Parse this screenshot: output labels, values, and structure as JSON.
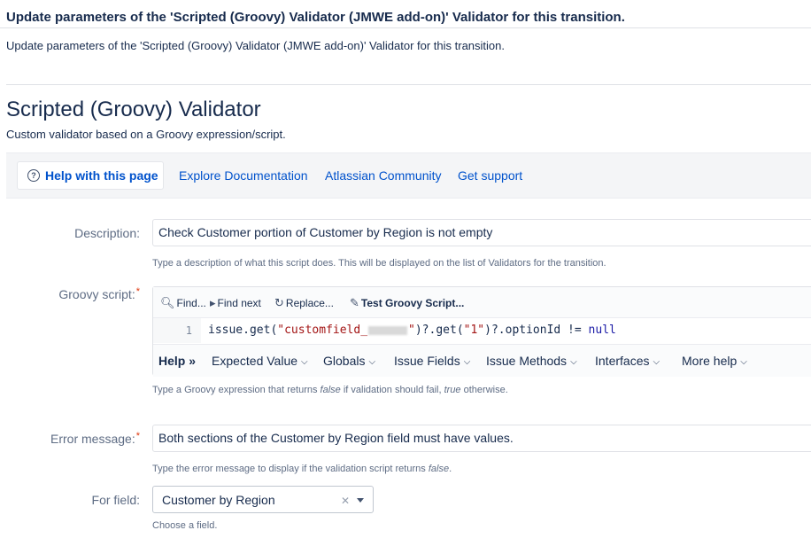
{
  "page": {
    "header_title": "Update parameters of the 'Scripted (Groovy) Validator (JMWE add-on)' Validator for this transition.",
    "description": "Update parameters of the 'Scripted (Groovy) Validator (JMWE add-on)' Validator for this transition."
  },
  "plugin": {
    "title": "Scripted (Groovy) Validator",
    "subtitle": "Custom validator based on a Groovy expression/script."
  },
  "help_bar": {
    "help_icon": "question-circle-icon",
    "help_page": "Help with this page",
    "links": [
      "Explore Documentation",
      "Atlassian Community",
      "Get support"
    ]
  },
  "form": {
    "description": {
      "label": "Description:",
      "value": "Check Customer portion of Customer by Region is not empty",
      "hint": "Type a description of what this script does. This will be displayed on the list of Validators for the transition."
    },
    "script": {
      "label": "Groovy script:",
      "required_marker": "*",
      "toolbar": {
        "find": "Find...",
        "find_next": "Find next",
        "replace": "Replace...",
        "test": "Test Groovy Script..."
      },
      "line_number": "1",
      "code": {
        "part1": "issue.get(",
        "str1": "\"customfield_",
        "str1_end": "\"",
        "part2": ")?.get(",
        "str2": "\"1\"",
        "part3": ")?.optionId != ",
        "kw": "null"
      },
      "help_menu": {
        "label": "Help",
        "items": [
          "Expected Value",
          "Globals",
          "Issue Fields",
          "Issue Methods",
          "Interfaces",
          "More help"
        ]
      },
      "hint_pre": "Type a Groovy expression that returns ",
      "hint_false": "false",
      "hint_mid": " if validation should fail, ",
      "hint_true": "true",
      "hint_post": " otherwise."
    },
    "error_message": {
      "label": "Error message:",
      "required_marker": "*",
      "value": "Both sections of the Customer by Region field must have values.",
      "hint_pre": "Type the error message to display if the validation script returns ",
      "hint_false": "false",
      "hint_post": "."
    },
    "for_field": {
      "label": "For field:",
      "value": "Customer by Region",
      "hint": "Choose a field."
    }
  }
}
